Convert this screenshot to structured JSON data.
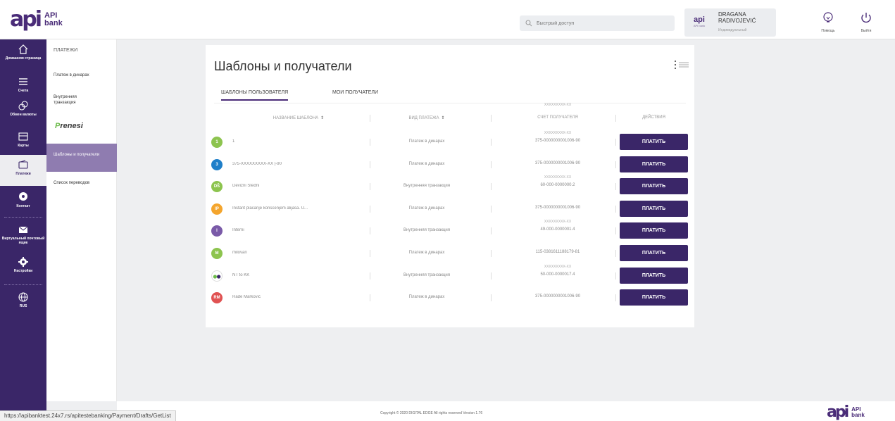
{
  "header": {
    "logo_mark": "api",
    "logo_line1": "API",
    "logo_line2": "bank",
    "search_placeholder": "Быстрый доступ",
    "user_name": "DRAGANA RADIVOJEVIĆ",
    "user_type": "Индивидуальный",
    "user_avatar_small": "API bank",
    "help_label": "Помощь",
    "logout_label": "Выйти"
  },
  "sidebar": {
    "items": [
      {
        "label": "Домашняя страница",
        "icon": "home-icon"
      },
      {
        "label": "Счета",
        "icon": "list-icon"
      },
      {
        "label": "Обмен валюты",
        "icon": "currency-exchange-icon"
      },
      {
        "label": "Карты",
        "icon": "card-icon"
      },
      {
        "label": "Платежи",
        "icon": "wallet-icon"
      },
      {
        "label": "Контакт",
        "icon": "chat-icon"
      },
      {
        "label": "Виртуальный почтовый ящик",
        "icon": "mail-icon"
      },
      {
        "label": "Настройки",
        "icon": "gear-icon"
      },
      {
        "label": "RUS",
        "icon": "globe-icon"
      }
    ]
  },
  "submenu": {
    "title": "ПЛАТЕЖИ",
    "items": [
      {
        "label": "Платеж в динарах"
      },
      {
        "label": "Внутренняя транзакция"
      },
      {
        "label": "Шаблоны и получатели"
      },
      {
        "label": "Список переводов"
      }
    ],
    "prenesi_p": "P",
    "prenesi_rest": "renesi"
  },
  "main": {
    "title": "Шаблоны и получатели",
    "tabs": [
      {
        "label": "ШАБЛОНЫ ПОЛЬЗОВАТЕЛЯ"
      },
      {
        "label": "МОИ ПОЛУЧАТЕЛИ"
      }
    ],
    "columns": {
      "name": "НАЗВАНИЕ ШАБЛОНА",
      "type": "ВИД ПЛАТЕЖА",
      "account_sub": "XXXXXXXXX-XX",
      "account": "СЧЕТ ПОЛУЧАТЕЛЯ",
      "actions": "ДЕЙСТВИЯ"
    },
    "pay_label": "ПЛАТИТЬ",
    "rows": [
      {
        "initials": "1",
        "color": "#8dc44f",
        "name": "1",
        "type": "Платеж в динарах",
        "account_sub": "XXXXXXXXX-XX",
        "account": "375-0000000001006-90"
      },
      {
        "initials": "3",
        "color": "#1f7fc9",
        "name": "375-XXXXXXXXX-XX |-90",
        "type": "Платеж в динарах",
        "account_sub": "",
        "account": "375-0000000001006-90"
      },
      {
        "initials": "DŠ",
        "color": "#8dc44f",
        "name": "Devizni Štedni",
        "type": "Внутренняя транзакция",
        "account_sub": "XXXXXXXXX-XX",
        "account": "60-000-0000000.2"
      },
      {
        "initials": "IP",
        "color": "#f4a52d",
        "name": "Instant placanje koriscenjem alijasa. U...",
        "type": "Платеж в динарах",
        "account_sub": "",
        "account": "375-0000000001006-90"
      },
      {
        "initials": "I",
        "color": "#7a5aa8",
        "name": "Interni",
        "type": "Внутренняя транзакция",
        "account_sub": "XXXXXXXXX-XX",
        "account": "49-000-0000001.4"
      },
      {
        "initials": "M",
        "color": "#8dc44f",
        "name": "milovan",
        "type": "Платеж в динарах",
        "account_sub": "",
        "account": "115-0381611188179-81"
      },
      {
        "initials": "",
        "color": "#ffffff",
        "name": "NT to KK",
        "type": "Внутренняя транзакция",
        "account_sub": "XXXXXXXXX-XX",
        "account": "50-000-0000017.4"
      },
      {
        "initials": "RM",
        "color": "#e05252",
        "name": "Rade Marković",
        "type": "Платеж в динарах",
        "account_sub": "",
        "account": "375-0000000001006-90"
      }
    ]
  },
  "footer": {
    "copyright": "Copyright © 2020 DIGITAL EDGE All rights reserved Version 1.76",
    "status_url": "https://apibanktest.24x7.rs/apitestebanking/Payment/Drafts/GetList"
  }
}
